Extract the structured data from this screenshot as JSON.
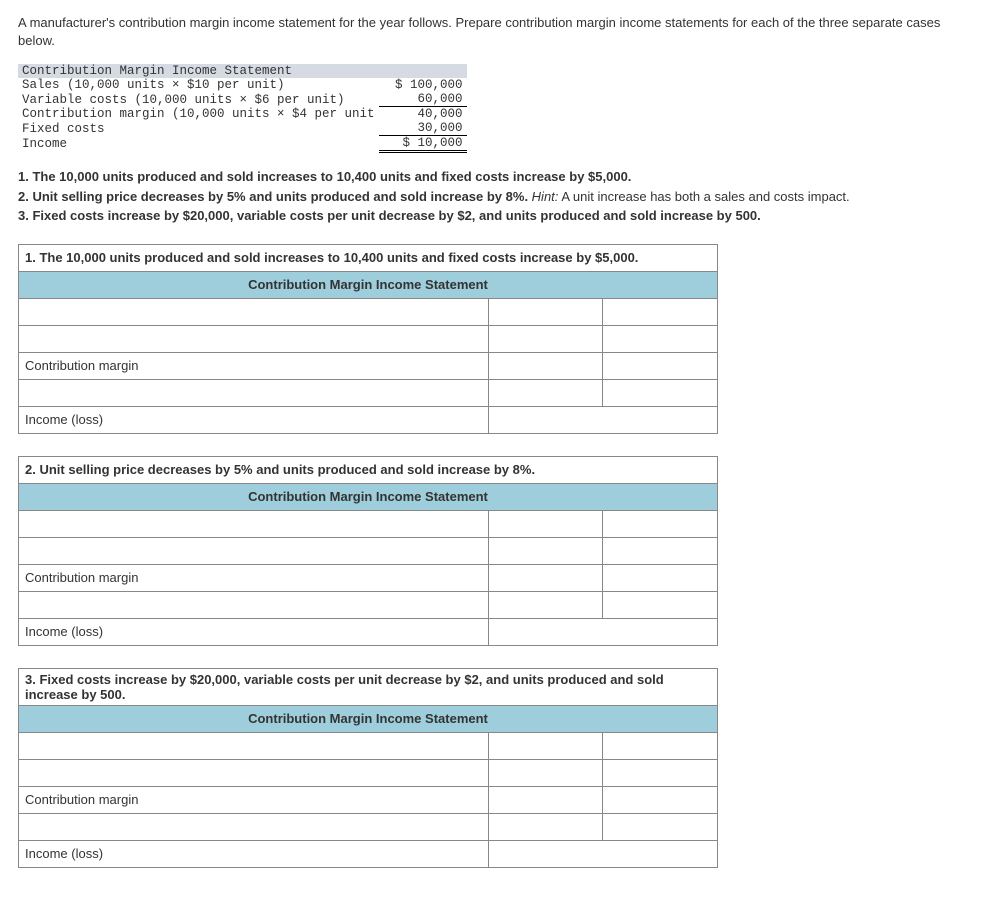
{
  "intro": "A manufacturer's contribution margin income statement for the year follows. Prepare contribution margin income statements for each of the three separate cases below.",
  "base": {
    "title": "Contribution Margin Income Statement",
    "rows": {
      "sales_label": "Sales (10,000 units × $10 per unit)",
      "sales_amt": "$ 100,000",
      "var_label": "Variable costs (10,000 units × $6 per unit)",
      "var_amt": "60,000",
      "cm_label": "Contribution margin (10,000 units × $4 per unit",
      "cm_amt": "40,000",
      "fixed_label": "Fixed costs",
      "fixed_amt": "30,000",
      "income_label": "Income",
      "income_amt": "$ 10,000"
    }
  },
  "scenarios": {
    "s1": "1. The 10,000 units produced and sold increases to 10,400 units and fixed costs increase by $5,000.",
    "s2a": "2. Unit selling price decreases by 5% and units produced and sold increase by 8%. ",
    "s2hint_label": "Hint:",
    "s2b": " A unit increase has both a sales and costs impact.",
    "s3": "3. Fixed costs increase by $20,000, variable costs per unit decrease by $2, and units produced and sold increase by 500."
  },
  "ws": {
    "section_hdr": "Contribution Margin Income Statement",
    "cm_label": "Contribution margin",
    "income_label": "Income (loss)",
    "p1": "1. The 10,000 units produced and sold increases to 10,400 units and fixed costs increase by $5,000.",
    "p2": "2. Unit selling price decreases by 5% and units produced and sold increase by 8%.",
    "p3": "3. Fixed costs increase by $20,000, variable costs per unit decrease by $2, and units produced and sold increase by 500."
  }
}
